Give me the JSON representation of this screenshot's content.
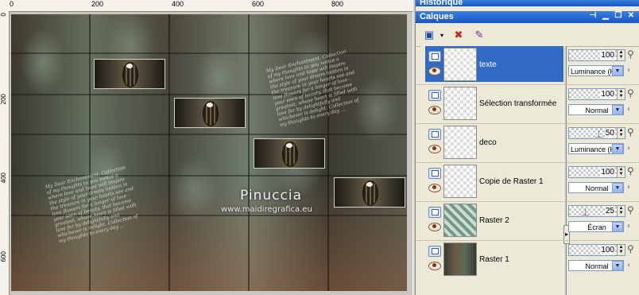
{
  "canvas": {
    "ruler_top_labels": [
      "0",
      "200",
      "400",
      "600",
      "800"
    ],
    "ruler_left_labels": [
      "0",
      "200",
      "400",
      "600"
    ],
    "watermark_title": "Pinuccia",
    "watermark_url": "www.maidiregrafica.eu",
    "script_text_1": "My Dear Enchantment, Collection of my thoughts to you notice a where love and hope will inspire the style of your dream hidden in the treasure in your hearts see and love flowers for a longer of love - your seen of beauty, that become greatest, whose heart is filled with love for by delightfully and whichever is delight. Collection of my thoughts to every day ...",
    "script_text_2": "My Dear Enchantment, Collection of my thoughts to you notice a where love and hope will inspire the style of your dream hidden in the treasure in your hearts see and love flowers for a longer of love - your seen of beauty, that become greatest, whose heart is filled with love for by delightfully and whichever is delight. Collection of my thoughts to every day ..."
  },
  "panels": {
    "historique_title": "Historique",
    "calques_title": "Calques",
    "titlebar_buttons": [
      "pin-icon",
      "minimize-icon",
      "restore-icon",
      "close-icon"
    ],
    "toolbar_icons": [
      "new-layer-icon",
      "dropdown-arrow-icon",
      "delete-layer-icon",
      "edit-selection-icon"
    ]
  },
  "layers": [
    {
      "name": "texte",
      "opacity": "100",
      "blend": "Luminance (H)",
      "selected": true
    },
    {
      "name": "Sélection transformée",
      "opacity": "100",
      "blend": "Normal",
      "selected": false
    },
    {
      "name": "deco",
      "opacity": "50",
      "blend": "Luminance (H)",
      "selected": false
    },
    {
      "name": "Copie de Raster 1",
      "opacity": "100",
      "blend": "Normal",
      "selected": false
    },
    {
      "name": "Raster 2",
      "opacity": "25",
      "blend": "Écran",
      "selected": false
    },
    {
      "name": "Raster 1",
      "opacity": "100",
      "blend": "Normal",
      "selected": false
    }
  ],
  "colors": {
    "titlebar": "#1456c4",
    "selected_row": "#316ac5",
    "panel_bg": "#ece9d8"
  }
}
